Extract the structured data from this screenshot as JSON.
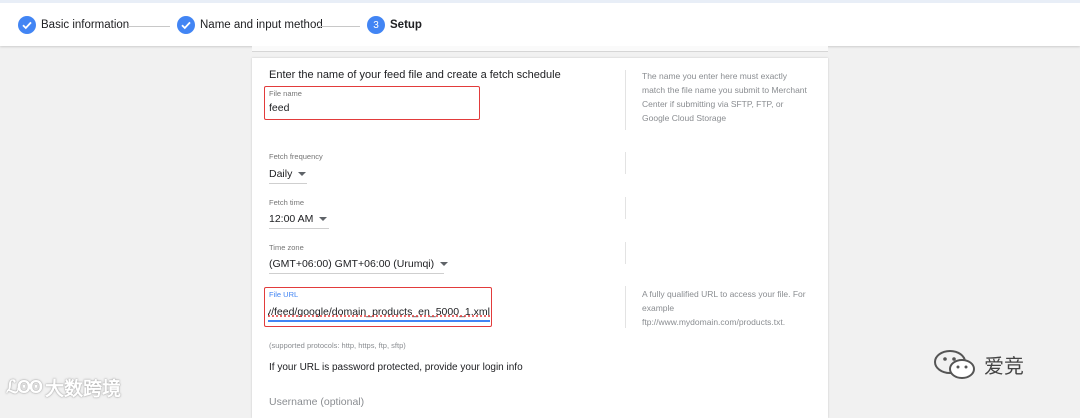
{
  "stepper": {
    "steps": [
      {
        "label": "Basic information",
        "state": "done"
      },
      {
        "label": "Name and input method",
        "state": "done"
      },
      {
        "number": "3",
        "label": "Setup",
        "state": "current"
      }
    ]
  },
  "form": {
    "heading": "Enter the name of your feed file and create a fetch schedule",
    "file_name": {
      "label": "File name",
      "value": "feed"
    },
    "file_name_hint": "The name you enter here must exactly match the file name you submit to Merchant Center if submitting via SFTP, FTP, or Google Cloud Storage",
    "fetch_frequency": {
      "label": "Fetch frequency",
      "value": "Daily"
    },
    "fetch_time": {
      "label": "Fetch time",
      "value": "12:00 AM"
    },
    "time_zone": {
      "label": "Time zone",
      "value": "(GMT+06:00) GMT+06:00 (Urumqi)"
    },
    "file_url": {
      "label": "File URL",
      "value": "y/feed/google/domain_products_en_5000_1.xml"
    },
    "file_url_hint": "A fully qualified URL to access your file. For example ftp://www.mydomain.com/products.txt.",
    "protocols_note": "(supported protocols: http, https, ftp, sftp)",
    "password_note": "If your URL is password protected, provide your login info",
    "username_label": "Username (optional)"
  },
  "watermarks": {
    "left_logo": "ℒʘʘ",
    "left_text": "大数跨境",
    "right_text": "爱竞"
  },
  "colors": {
    "accent": "#4285f4",
    "highlight": "#e23b3b",
    "background": "#f1f1f1"
  }
}
